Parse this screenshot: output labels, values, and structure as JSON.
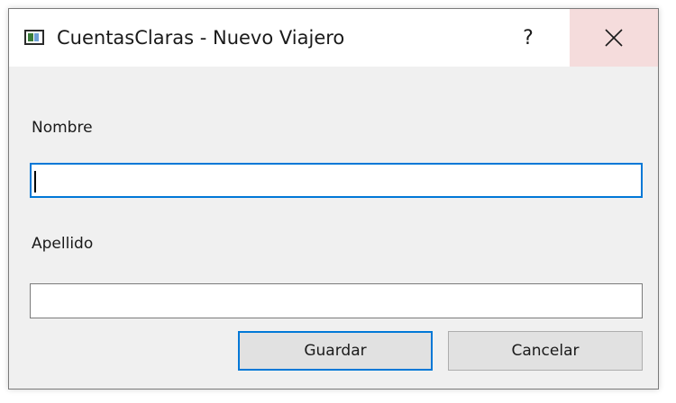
{
  "window": {
    "title": "CuentasClaras - Nuevo Viajero",
    "help_label": "?",
    "app_icon": "app-window-icon",
    "close_icon": "close-icon"
  },
  "form": {
    "nombre_label": "Nombre",
    "nombre_value": "",
    "apellido_label": "Apellido",
    "apellido_value": ""
  },
  "buttons": {
    "save_label": "Guardar",
    "cancel_label": "Cancelar"
  },
  "colors": {
    "accent": "#0078d7",
    "close_hover_bg": "#f5dcdc",
    "dialog_bg": "#f0f0f0"
  }
}
